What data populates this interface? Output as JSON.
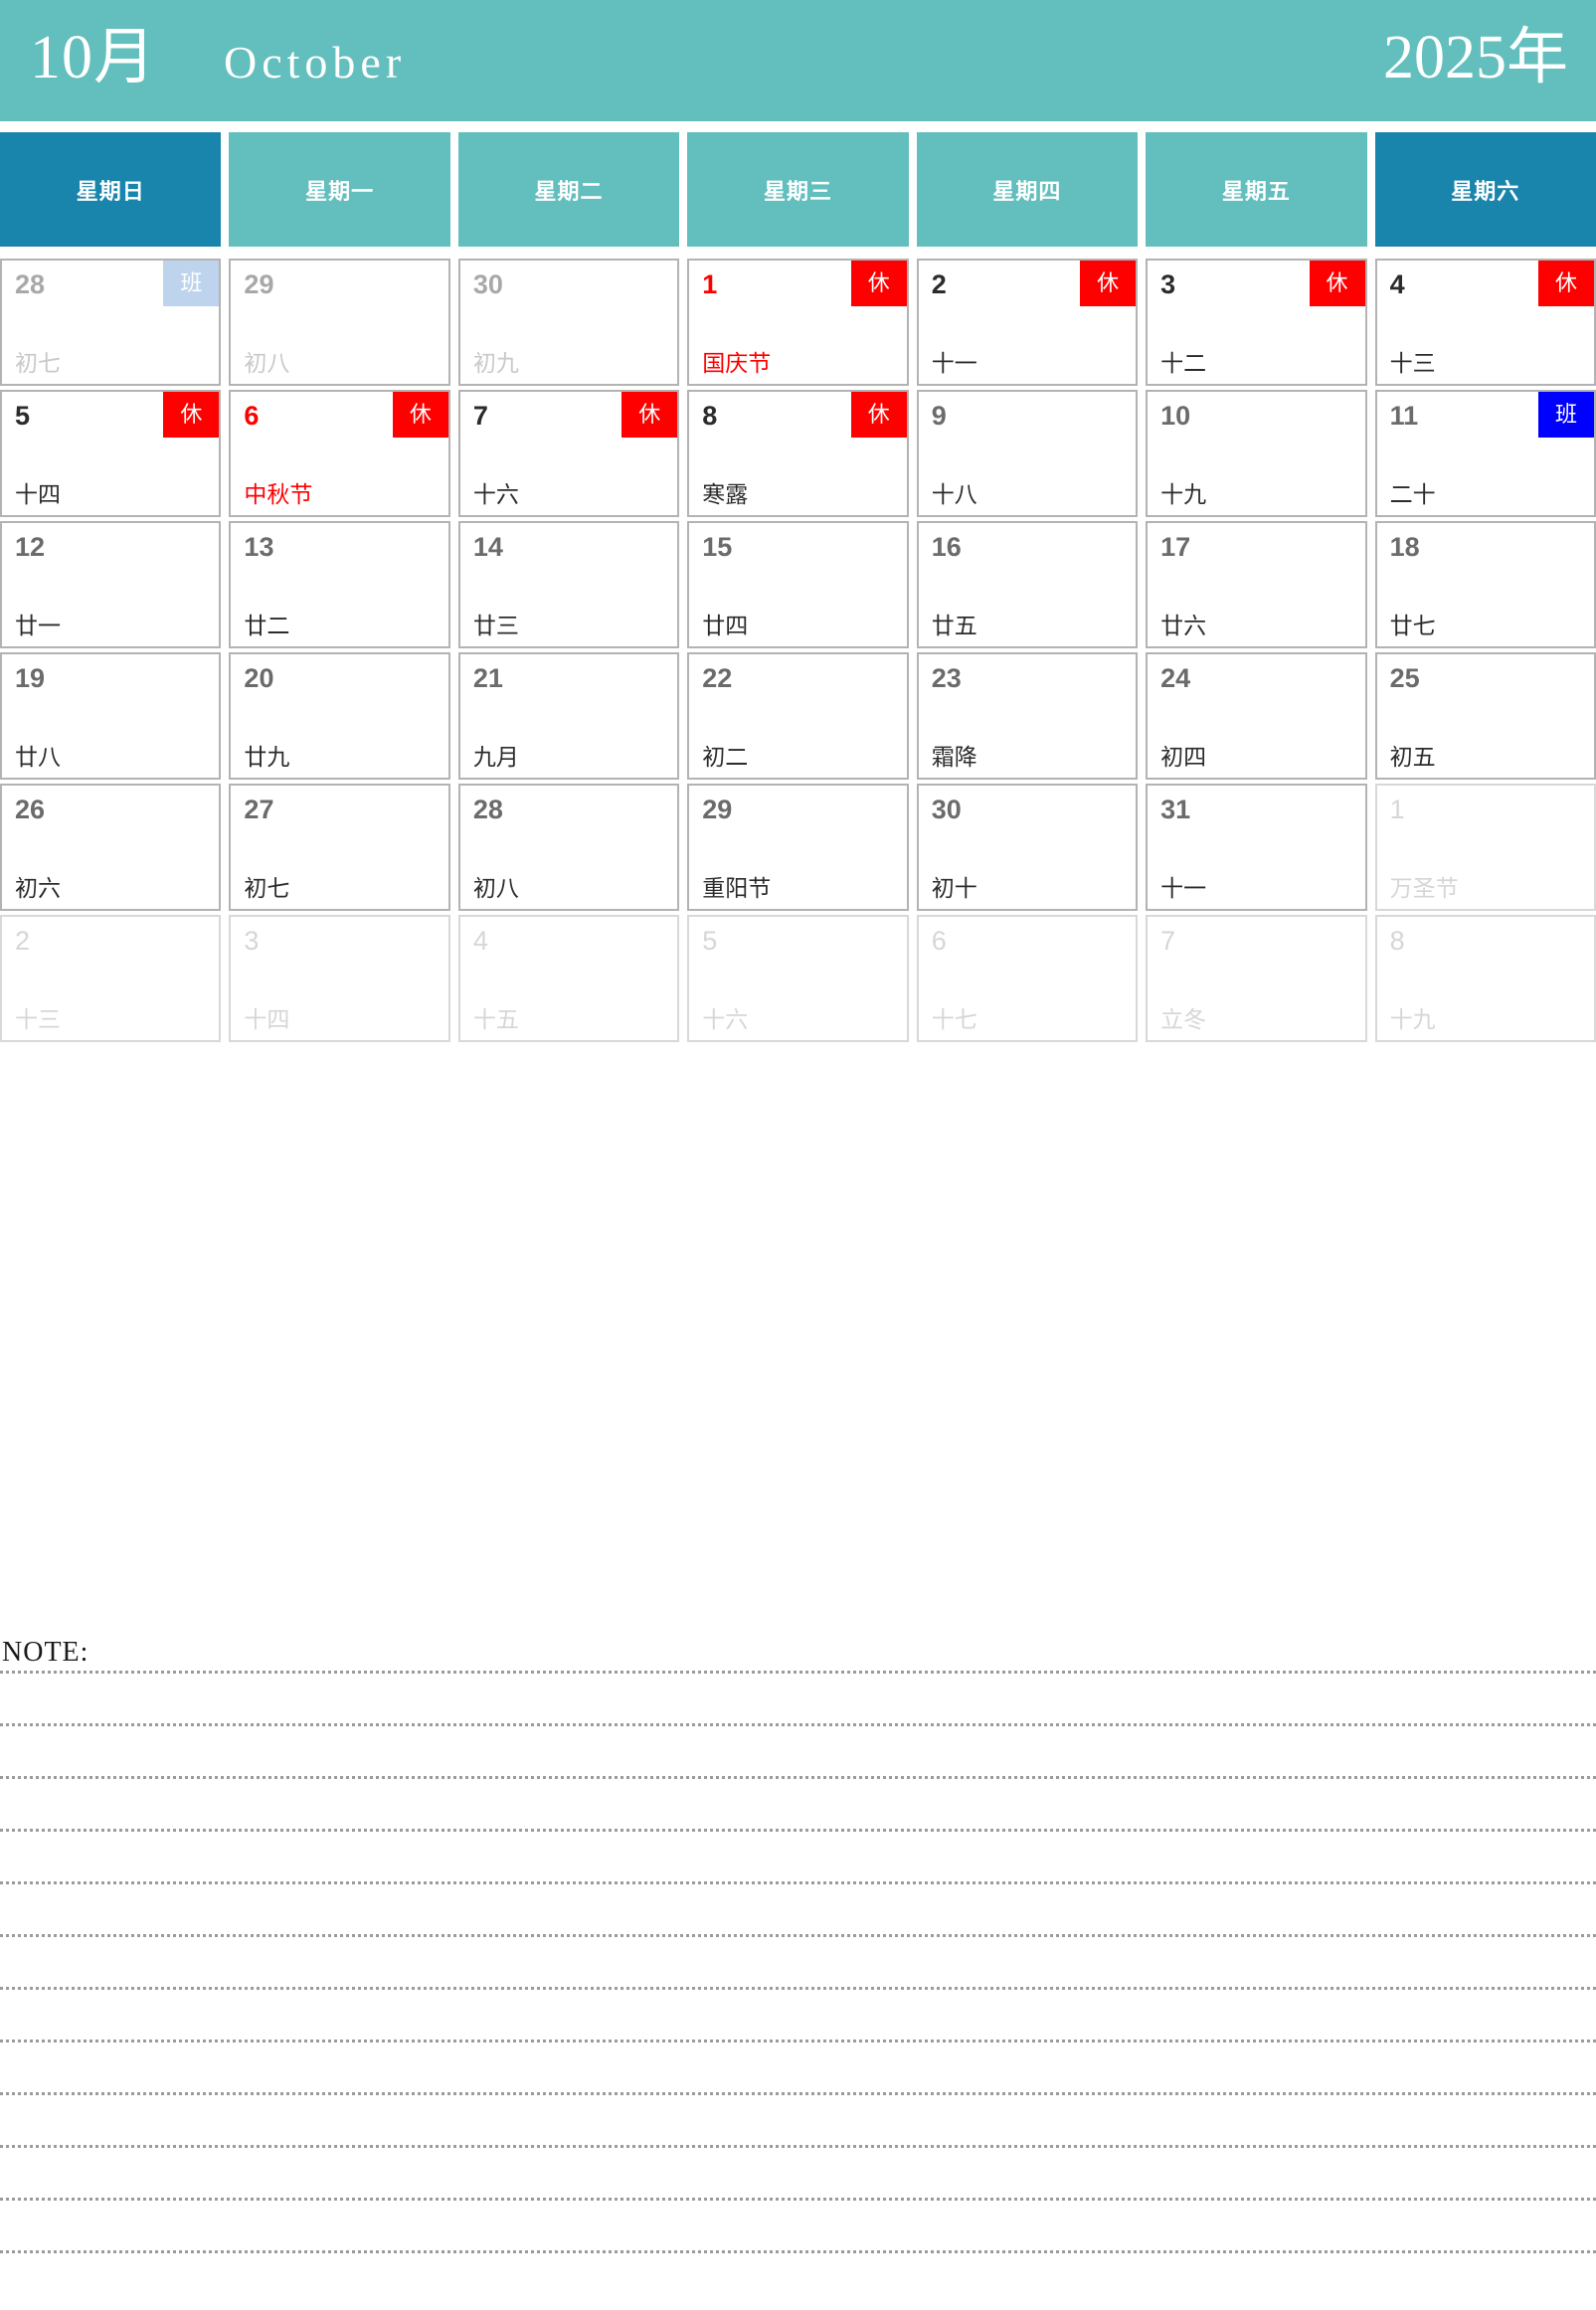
{
  "title": {
    "month_cn": "10月",
    "month_en": "October",
    "year_cn": "2025年"
  },
  "colors": {
    "header_teal": "#62bfbd",
    "weekend_blue": "#1a85ac",
    "rest_badge": "#ff0000",
    "work_badge": "#0000ff",
    "work_badge_light": "#bed4ec",
    "holiday_text": "#ff0000",
    "cell_border": "#b3b3b3"
  },
  "weekdays": [
    {
      "label": "星期日",
      "weekend": true
    },
    {
      "label": "星期一",
      "weekend": false
    },
    {
      "label": "星期二",
      "weekend": false
    },
    {
      "label": "星期三",
      "weekend": false
    },
    {
      "label": "星期四",
      "weekend": false
    },
    {
      "label": "星期五",
      "weekend": false
    },
    {
      "label": "星期六",
      "weekend": true
    }
  ],
  "weeks": [
    [
      {
        "day": "28",
        "lunar": "初七",
        "badge": "班",
        "badge_type": "worklite",
        "num_style": "gray",
        "lunar_style": "gray",
        "outside": true
      },
      {
        "day": "29",
        "lunar": "初八",
        "badge": "",
        "badge_type": "",
        "num_style": "gray",
        "lunar_style": "gray",
        "outside": true
      },
      {
        "day": "30",
        "lunar": "初九",
        "badge": "",
        "badge_type": "",
        "num_style": "gray",
        "lunar_style": "gray",
        "outside": true
      },
      {
        "day": "1",
        "lunar": "国庆节",
        "badge": "休",
        "badge_type": "rest",
        "num_style": "red",
        "lunar_style": "red",
        "outside": false
      },
      {
        "day": "2",
        "lunar": "十一",
        "badge": "休",
        "badge_type": "rest",
        "num_style": "dark",
        "lunar_style": "",
        "outside": false
      },
      {
        "day": "3",
        "lunar": "十二",
        "badge": "休",
        "badge_type": "rest",
        "num_style": "dark",
        "lunar_style": "",
        "outside": false
      },
      {
        "day": "4",
        "lunar": "十三",
        "badge": "休",
        "badge_type": "rest",
        "num_style": "dark",
        "lunar_style": "",
        "outside": false
      }
    ],
    [
      {
        "day": "5",
        "lunar": "十四",
        "badge": "休",
        "badge_type": "rest",
        "num_style": "dark",
        "lunar_style": "",
        "outside": false
      },
      {
        "day": "6",
        "lunar": "中秋节",
        "badge": "休",
        "badge_type": "rest",
        "num_style": "red",
        "lunar_style": "red",
        "outside": false
      },
      {
        "day": "7",
        "lunar": "十六",
        "badge": "休",
        "badge_type": "rest",
        "num_style": "dark",
        "lunar_style": "",
        "outside": false
      },
      {
        "day": "8",
        "lunar": "寒露",
        "badge": "休",
        "badge_type": "rest",
        "num_style": "dark",
        "lunar_style": "",
        "outside": false
      },
      {
        "day": "9",
        "lunar": "十八",
        "badge": "",
        "badge_type": "",
        "num_style": "",
        "lunar_style": "",
        "outside": false
      },
      {
        "day": "10",
        "lunar": "十九",
        "badge": "",
        "badge_type": "",
        "num_style": "",
        "lunar_style": "",
        "outside": false
      },
      {
        "day": "11",
        "lunar": "二十",
        "badge": "班",
        "badge_type": "work",
        "num_style": "",
        "lunar_style": "",
        "outside": false
      }
    ],
    [
      {
        "day": "12",
        "lunar": "廿一",
        "badge": "",
        "badge_type": "",
        "num_style": "",
        "lunar_style": "",
        "outside": false
      },
      {
        "day": "13",
        "lunar": "廿二",
        "badge": "",
        "badge_type": "",
        "num_style": "",
        "lunar_style": "",
        "outside": false
      },
      {
        "day": "14",
        "lunar": "廿三",
        "badge": "",
        "badge_type": "",
        "num_style": "",
        "lunar_style": "",
        "outside": false
      },
      {
        "day": "15",
        "lunar": "廿四",
        "badge": "",
        "badge_type": "",
        "num_style": "",
        "lunar_style": "",
        "outside": false
      },
      {
        "day": "16",
        "lunar": "廿五",
        "badge": "",
        "badge_type": "",
        "num_style": "",
        "lunar_style": "",
        "outside": false
      },
      {
        "day": "17",
        "lunar": "廿六",
        "badge": "",
        "badge_type": "",
        "num_style": "",
        "lunar_style": "",
        "outside": false
      },
      {
        "day": "18",
        "lunar": "廿七",
        "badge": "",
        "badge_type": "",
        "num_style": "",
        "lunar_style": "",
        "outside": false
      }
    ],
    [
      {
        "day": "19",
        "lunar": "廿八",
        "badge": "",
        "badge_type": "",
        "num_style": "",
        "lunar_style": "",
        "outside": false
      },
      {
        "day": "20",
        "lunar": "廿九",
        "badge": "",
        "badge_type": "",
        "num_style": "",
        "lunar_style": "",
        "outside": false
      },
      {
        "day": "21",
        "lunar": "九月",
        "badge": "",
        "badge_type": "",
        "num_style": "",
        "lunar_style": "",
        "outside": false
      },
      {
        "day": "22",
        "lunar": "初二",
        "badge": "",
        "badge_type": "",
        "num_style": "",
        "lunar_style": "",
        "outside": false
      },
      {
        "day": "23",
        "lunar": "霜降",
        "badge": "",
        "badge_type": "",
        "num_style": "",
        "lunar_style": "",
        "outside": false
      },
      {
        "day": "24",
        "lunar": "初四",
        "badge": "",
        "badge_type": "",
        "num_style": "",
        "lunar_style": "",
        "outside": false
      },
      {
        "day": "25",
        "lunar": "初五",
        "badge": "",
        "badge_type": "",
        "num_style": "",
        "lunar_style": "",
        "outside": false
      }
    ],
    [
      {
        "day": "26",
        "lunar": "初六",
        "badge": "",
        "badge_type": "",
        "num_style": "",
        "lunar_style": "",
        "outside": false
      },
      {
        "day": "27",
        "lunar": "初七",
        "badge": "",
        "badge_type": "",
        "num_style": "",
        "lunar_style": "",
        "outside": false
      },
      {
        "day": "28",
        "lunar": "初八",
        "badge": "",
        "badge_type": "",
        "num_style": "",
        "lunar_style": "",
        "outside": false
      },
      {
        "day": "29",
        "lunar": "重阳节",
        "badge": "",
        "badge_type": "",
        "num_style": "",
        "lunar_style": "",
        "outside": false
      },
      {
        "day": "30",
        "lunar": "初十",
        "badge": "",
        "badge_type": "",
        "num_style": "",
        "lunar_style": "",
        "outside": false
      },
      {
        "day": "31",
        "lunar": "十一",
        "badge": "",
        "badge_type": "",
        "num_style": "",
        "lunar_style": "",
        "outside": false
      },
      {
        "day": "1",
        "lunar": "万圣节",
        "badge": "",
        "badge_type": "",
        "num_style": "faint",
        "lunar_style": "faint",
        "outside": true
      }
    ],
    [
      {
        "day": "2",
        "lunar": "十三",
        "badge": "",
        "badge_type": "",
        "num_style": "faint",
        "lunar_style": "faint",
        "outside": true
      },
      {
        "day": "3",
        "lunar": "十四",
        "badge": "",
        "badge_type": "",
        "num_style": "faint",
        "lunar_style": "faint",
        "outside": true
      },
      {
        "day": "4",
        "lunar": "十五",
        "badge": "",
        "badge_type": "",
        "num_style": "faint",
        "lunar_style": "faint",
        "outside": true
      },
      {
        "day": "5",
        "lunar": "十六",
        "badge": "",
        "badge_type": "",
        "num_style": "faint",
        "lunar_style": "faint",
        "outside": true
      },
      {
        "day": "6",
        "lunar": "十七",
        "badge": "",
        "badge_type": "",
        "num_style": "faint",
        "lunar_style": "faint",
        "outside": true
      },
      {
        "day": "7",
        "lunar": "立冬",
        "badge": "",
        "badge_type": "",
        "num_style": "faint",
        "lunar_style": "faint",
        "outside": true
      },
      {
        "day": "8",
        "lunar": "十九",
        "badge": "",
        "badge_type": "",
        "num_style": "faint",
        "lunar_style": "faint",
        "outside": true
      }
    ]
  ],
  "note": {
    "label": "NOTE:",
    "line_count": 12
  }
}
